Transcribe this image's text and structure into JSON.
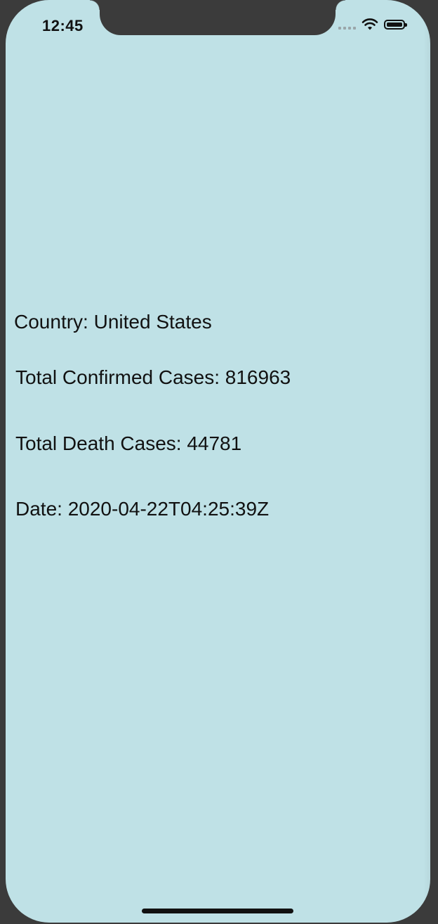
{
  "status_bar": {
    "time": "12:45",
    "icons": [
      "signal-icon",
      "wifi-icon",
      "battery-icon"
    ]
  },
  "main": {
    "country": "Country: United States",
    "confirmed": "Total Confirmed Cases: 816963",
    "deaths": "Total Death Cases: 44781",
    "date": "Date: 2020-04-22T04:25:39Z"
  },
  "colors": {
    "background": "#bfe1e6",
    "frame": "#3b3b3b",
    "text": "#111111"
  }
}
